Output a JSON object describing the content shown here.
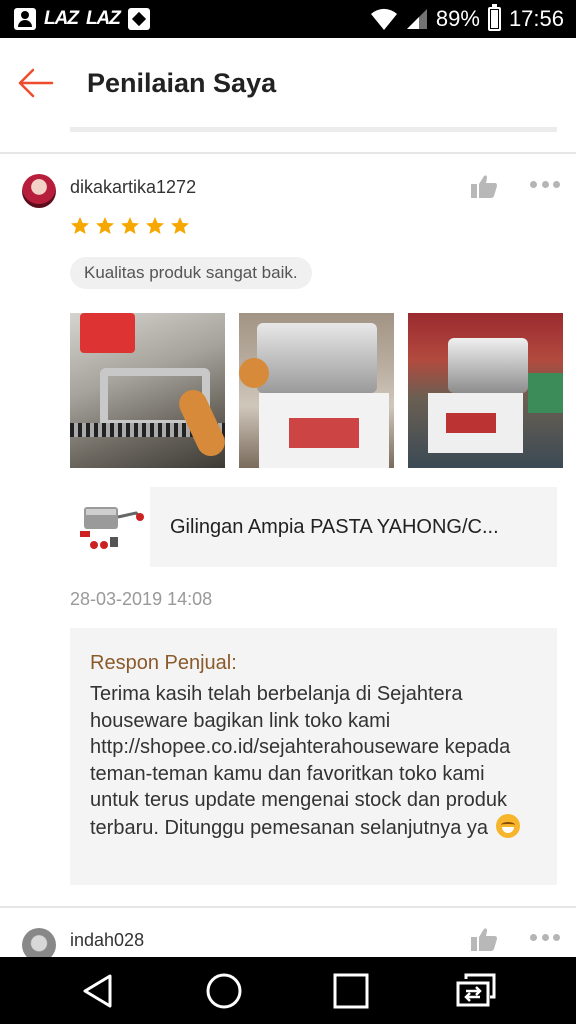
{
  "status_bar": {
    "app_labels": [
      "LAZ",
      "LAZ"
    ],
    "battery": "89%",
    "time": "17:56",
    "battery_level": 0.89
  },
  "header": {
    "title": "Penilaian Saya",
    "back_icon": "arrow-left-icon",
    "accent_color": "#ee4d2d"
  },
  "reviews": [
    {
      "username": "dikakartika1272",
      "rating": 5,
      "rating_max": 5,
      "comment": "Kualitas produk sangat baik.",
      "product_name": "Gilingan Ampia PASTA YAHONG/C...",
      "date": "28-03-2019 14:08",
      "seller_reply_label": "Respon Penjual:",
      "seller_reply_text": "Terima kasih telah berbelanja di Sejahtera houseware bagikan link toko kami http://shopee.co.id/sejahterahouseware kepada teman-teman kamu dan favoritkan toko kami untuk terus update mengenai stock dan produk terbaru. Ditunggu pemesanan selanjutnya ya"
    },
    {
      "username": "indah028"
    }
  ],
  "colors": {
    "star": "#f6a700",
    "reply_label": "#8b5a2b"
  }
}
